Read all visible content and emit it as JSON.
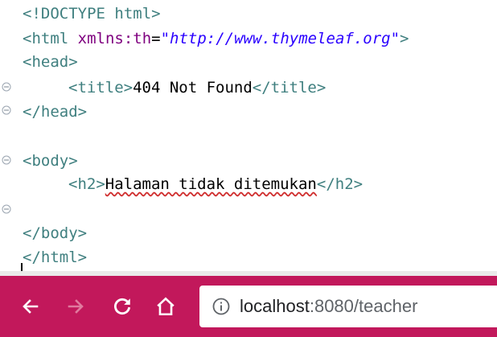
{
  "editor": {
    "doctype": "<!DOCTYPE html>",
    "html_open_tag": "<html ",
    "html_attr_name": "xmlns:th",
    "html_attr_eq": "=",
    "html_attr_value": "\"http://www.thymeleaf.org\"",
    "html_open_close": ">",
    "head_open": "<head>",
    "title_open": "<title>",
    "title_text": "404 Not Found",
    "title_close": "</title>",
    "head_close": "</head>",
    "body_open": "<body>",
    "h2_open": "<h2>",
    "h2_text": "Halaman tidak ditemukan",
    "h2_close": "</h2>",
    "body_close": "</body>",
    "html_close": "</html>"
  },
  "browser": {
    "back_icon": "arrow-left-icon",
    "forward_icon": "arrow-right-icon",
    "reload_icon": "reload-icon",
    "home_icon": "home-icon",
    "info_icon": "info-icon",
    "url_host": "localhost",
    "url_rest": ":8080/teacher",
    "bar_color": "#c2185b"
  }
}
